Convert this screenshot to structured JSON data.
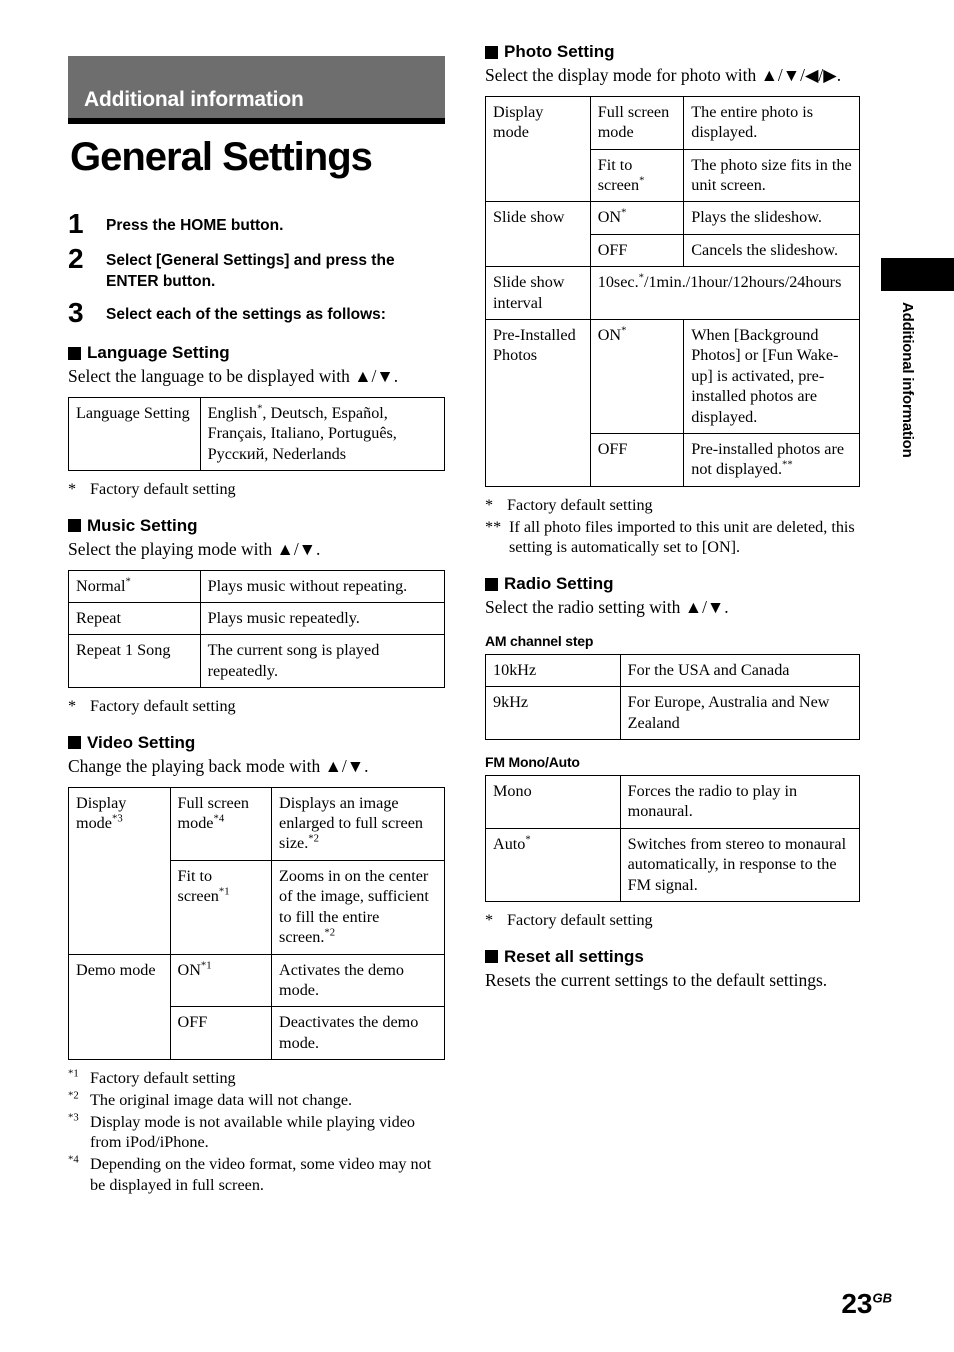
{
  "chapter": {
    "band_title": "Additional information"
  },
  "page_title": "General Settings",
  "side_tab": {
    "label": "Additional information"
  },
  "folio": {
    "number": "23",
    "suffix": "GB"
  },
  "steps": [
    {
      "num": "1",
      "text": "Press the HOME button."
    },
    {
      "num": "2",
      "text": "Select [General Settings] and press the ENTER button."
    },
    {
      "num": "3",
      "text": "Select each of the settings as follows:"
    }
  ],
  "language_setting": {
    "heading": "Language Setting",
    "intro": "Select the language to be displayed with ▲/▼.",
    "row_label": "Language Setting",
    "values_line1_pre": "English",
    "values_line1_post": ", Deutsch, Español,",
    "values_line2": "Français, Italiano, Português,",
    "values_line3": "Русский, Nederlands",
    "footnote": "Factory default setting",
    "footnote_mark": "*"
  },
  "music_setting": {
    "heading": "Music Setting",
    "intro": "Select the playing mode with ▲/▼.",
    "rows": [
      {
        "mode": "Normal",
        "mode_sup": "*",
        "desc": "Plays music without repeating."
      },
      {
        "mode": "Repeat",
        "mode_sup": "",
        "desc": "Plays music repeatedly."
      },
      {
        "mode": "Repeat 1 Song",
        "mode_sup": "",
        "desc": "The current song is played repeatedly."
      }
    ],
    "footnote": "Factory default setting",
    "footnote_mark": "*"
  },
  "video_setting": {
    "heading": "Video Setting",
    "intro": "Change the playing back mode with ▲/▼.",
    "group1_label": "Display mode",
    "group1_sup": "*3",
    "group1_rows": [
      {
        "opt": "Full screen mode",
        "opt_sup": "*4",
        "desc": "Displays an image enlarged to full screen size.",
        "desc_sup": "*2"
      },
      {
        "opt": "Fit to screen",
        "opt_sup": "*1",
        "desc": "Zooms in on the center of the image, sufficient to fill the entire screen.",
        "desc_sup": "*2"
      }
    ],
    "group2_label": "Demo mode",
    "group2_sup": "",
    "group2_rows": [
      {
        "opt": "ON",
        "opt_sup": "*1",
        "desc": "Activates the demo mode.",
        "desc_sup": ""
      },
      {
        "opt": "OFF",
        "opt_sup": "",
        "desc": "Deactivates the demo mode.",
        "desc_sup": ""
      }
    ],
    "footnotes": [
      {
        "mark": "*1",
        "text": "Factory default setting"
      },
      {
        "mark": "*2",
        "text": "The original image data will not change."
      },
      {
        "mark": "*3",
        "text": "Display mode is not available while playing video from iPod/iPhone."
      },
      {
        "mark": "*4",
        "text": "Depending on the video format, some video may not be displayed in full screen."
      }
    ]
  },
  "photo_setting": {
    "heading": "Photo Setting",
    "intro": "Select the display mode for photo with ▲/▼/◀/▶.",
    "group1_label": "Display mode",
    "group1_rows": [
      {
        "opt": "Full screen mode",
        "opt_sup": "",
        "desc": "The entire photo is displayed.",
        "desc_sup": ""
      },
      {
        "opt": "Fit to screen",
        "opt_sup": "*",
        "desc": "The photo size fits in the unit screen.",
        "desc_sup": ""
      }
    ],
    "group2_label": "Slide show",
    "group2_rows": [
      {
        "opt": "ON",
        "opt_sup": "*",
        "desc": "Plays the slideshow.",
        "desc_sup": ""
      },
      {
        "opt": "OFF",
        "opt_sup": "",
        "desc": "Cancels the slideshow.",
        "desc_sup": ""
      }
    ],
    "interval_label": "Slide show interval",
    "interval_value_pre": "10sec.",
    "interval_value_sup": "*",
    "interval_value_post": "/1min./1hour/12hours/24hours",
    "group3_label": "Pre-Installed Photos",
    "group3_rows": [
      {
        "opt": "ON",
        "opt_sup": "*",
        "desc": "When [Background Photos] or [Fun Wake-up] is activated, pre-installed photos are displayed.",
        "desc_sup": ""
      },
      {
        "opt": "OFF",
        "opt_sup": "",
        "desc": "Pre-installed photos are not displayed.",
        "desc_sup": "**"
      }
    ],
    "footnotes": [
      {
        "mark": "*",
        "text": "Factory default setting"
      },
      {
        "mark": "**",
        "text": "If all photo files imported to this unit are deleted, this setting is automatically set to [ON]."
      }
    ]
  },
  "radio_setting": {
    "heading": "Radio Setting",
    "intro": "Select the radio setting with ▲/▼.",
    "am_subhead": "AM channel step",
    "am_rows": [
      {
        "opt": "10kHz",
        "opt_sup": "",
        "desc": "For the USA and Canada"
      },
      {
        "opt": "9kHz",
        "opt_sup": "",
        "desc": "For Europe, Australia and New Zealand"
      }
    ],
    "fm_subhead": "FM Mono/Auto",
    "fm_rows": [
      {
        "opt": "Mono",
        "opt_sup": "",
        "desc": "Forces the radio to play in monaural."
      },
      {
        "opt": "Auto",
        "opt_sup": "*",
        "desc": "Switches from stereo to monaural automatically, in response to the FM signal."
      }
    ],
    "footnote_mark": "*",
    "footnote": "Factory default setting"
  },
  "reset_settings": {
    "heading": "Reset all settings",
    "intro": "Resets the current settings to the default settings."
  }
}
